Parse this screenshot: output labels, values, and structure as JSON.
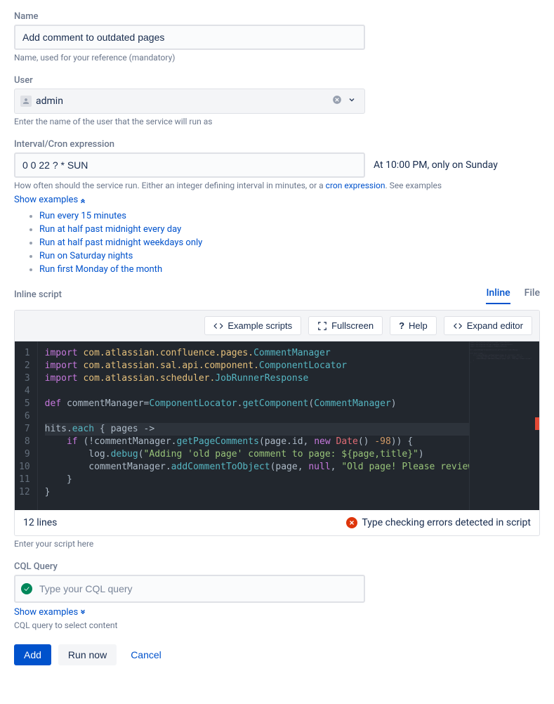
{
  "name_field": {
    "label": "Name",
    "value": "Add comment to outdated pages",
    "help": "Name, used for your reference (mandatory)"
  },
  "user_field": {
    "label": "User",
    "value": "admin",
    "help": "Enter the name of the user that the service will run as"
  },
  "interval_field": {
    "label": "Interval/Cron expression",
    "value": "0 0 22 ? * SUN",
    "description": "At 10:00 PM, only on Sunday",
    "help_pre": "How often should the service run. Either an integer defining interval in minutes, or a ",
    "cron_link": "cron expression",
    "help_post": ". See examples",
    "show_examples": "Show examples",
    "examples": [
      "Run every 15 minutes",
      "Run at half past midnight every day",
      "Run at half past midnight weekdays only",
      "Run on Saturday nights",
      "Run first Monday of the month"
    ]
  },
  "script_field": {
    "label": "Inline script",
    "tabs": {
      "inline": "Inline",
      "file": "File"
    },
    "toolbar": {
      "examples": "Example scripts",
      "fullscreen": "Fullscreen",
      "help": "Help",
      "expand": "Expand editor"
    },
    "code_lines": [
      "import com.atlassian.confluence.pages.CommentManager",
      "import com.atlassian.sal.api.component.ComponentLocator",
      "import com.atlassian.scheduler.JobRunnerResponse",
      "",
      "def commentManager=ComponentLocator.getComponent(CommentManager)",
      "",
      "hits.each { pages ->",
      "    if (!commentManager.getPageComments(page.id, new Date() -98)) {",
      "        log.debug(\"Adding 'old page' comment to page: ${page,title}\")",
      "        commentManager.addCommentToObject(page, null, \"Old page! Please review\")",
      "    }",
      "}"
    ],
    "footer_lines": "12 lines",
    "footer_error": "Type checking errors detected in script",
    "help": "Enter your script here"
  },
  "cql_field": {
    "label": "CQL Query",
    "placeholder": "Type your CQL query",
    "show_examples": "Show examples",
    "help": "CQL query to select content"
  },
  "actions": {
    "add": "Add",
    "run": "Run now",
    "cancel": "Cancel"
  }
}
